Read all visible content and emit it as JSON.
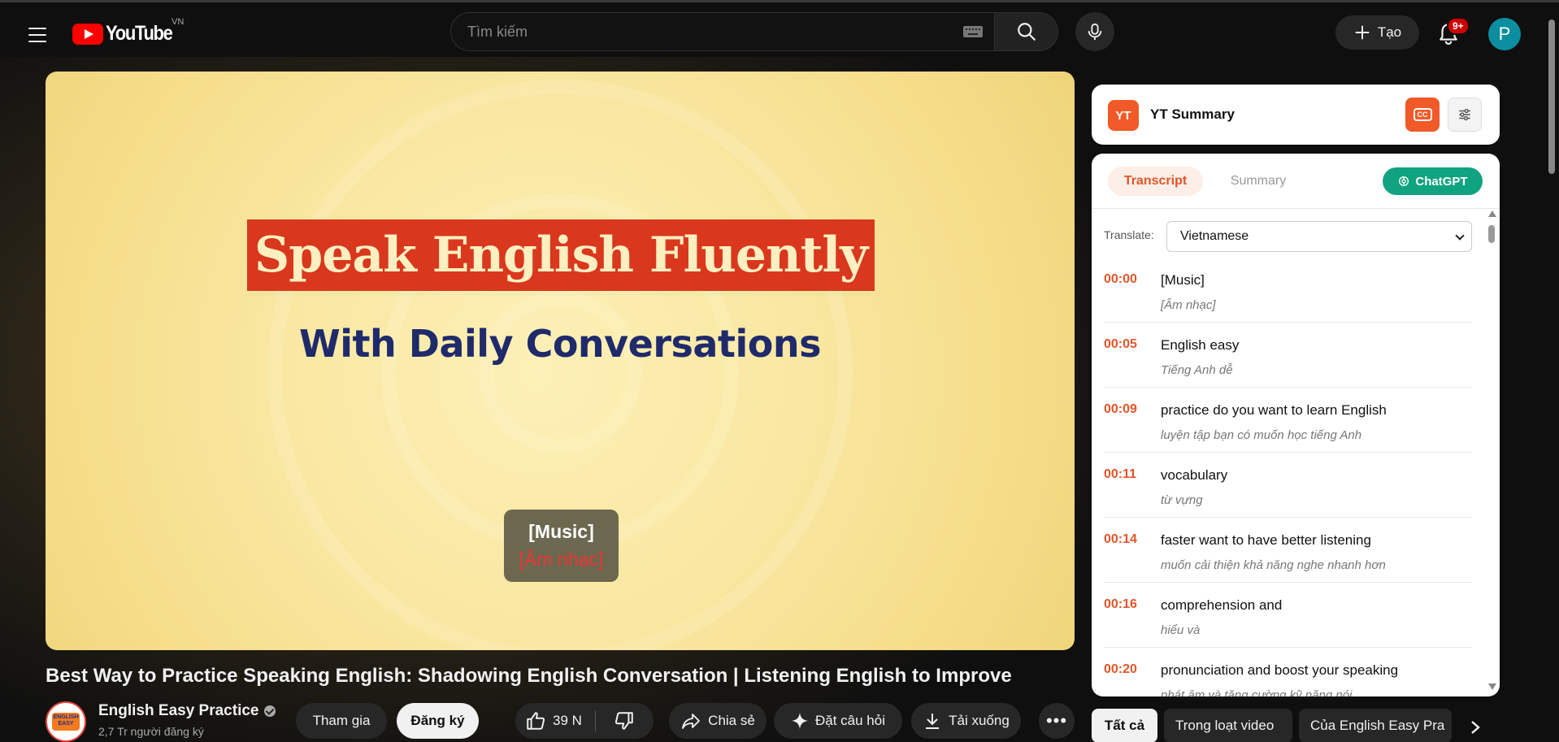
{
  "header": {
    "logo_text": "YouTube",
    "country_code": "VN",
    "search_placeholder": "Tìm kiếm",
    "create_label": "Tạo",
    "notification_count": "9+",
    "avatar_letter": "P"
  },
  "video": {
    "banner_title": "Speak English Fluently",
    "banner_subtitle": "With Daily Conversations",
    "caption_line1": "[Music]",
    "caption_line2": "[Âm nhạc]",
    "title": "Best Way to Practice Speaking English: Shadowing English Conversation | Listening English to Improve"
  },
  "channel": {
    "avatar_text": "ENGLISH EASY",
    "name": "English Easy Practice",
    "subscribers": "2,7 Tr người đăng ký",
    "join_label": "Tham gia",
    "subscribe_label": "Đăng ký"
  },
  "actions": {
    "like_count": "39 N",
    "share_label": "Chia sẻ",
    "ask_label": "Đặt câu hỏi",
    "download_label": "Tải xuống",
    "more_label": "•••"
  },
  "extension": {
    "badge": "YT",
    "title": "YT Summary",
    "cc_label": "CC",
    "tabs": {
      "transcript": "Transcript",
      "summary": "Summary"
    },
    "chatgpt_label": "ChatGPT",
    "translate_label": "Translate:",
    "translate_value": "Vietnamese",
    "transcript": [
      {
        "time": "00:00",
        "en": "[Music]",
        "vi": "[Âm nhạc]"
      },
      {
        "time": "00:05",
        "en": "English easy",
        "vi": "Tiếng Anh dễ"
      },
      {
        "time": "00:09",
        "en": "practice do you want to learn English",
        "vi": "luyện tập bạn có muốn học tiếng Anh"
      },
      {
        "time": "00:11",
        "en": "vocabulary",
        "vi": "từ vựng"
      },
      {
        "time": "00:14",
        "en": "faster want to have better listening",
        "vi": "muốn cải thiện khả năng nghe nhanh hơn"
      },
      {
        "time": "00:16",
        "en": "comprehension and",
        "vi": "hiểu và"
      },
      {
        "time": "00:20",
        "en": "pronunciation and boost your speaking",
        "vi": "phát âm và tăng cường kỹ năng nói"
      }
    ]
  },
  "chips": {
    "all": "Tất cả",
    "series": "Trong loạt video",
    "channel": "Của English Easy Pra"
  },
  "colors": {
    "accent_orange": "#f05a28",
    "chatgpt_green": "#10a37f",
    "youtube_red": "#ff0000",
    "banner_red": "#d9381e",
    "banner_navy": "#1f2a6b"
  }
}
